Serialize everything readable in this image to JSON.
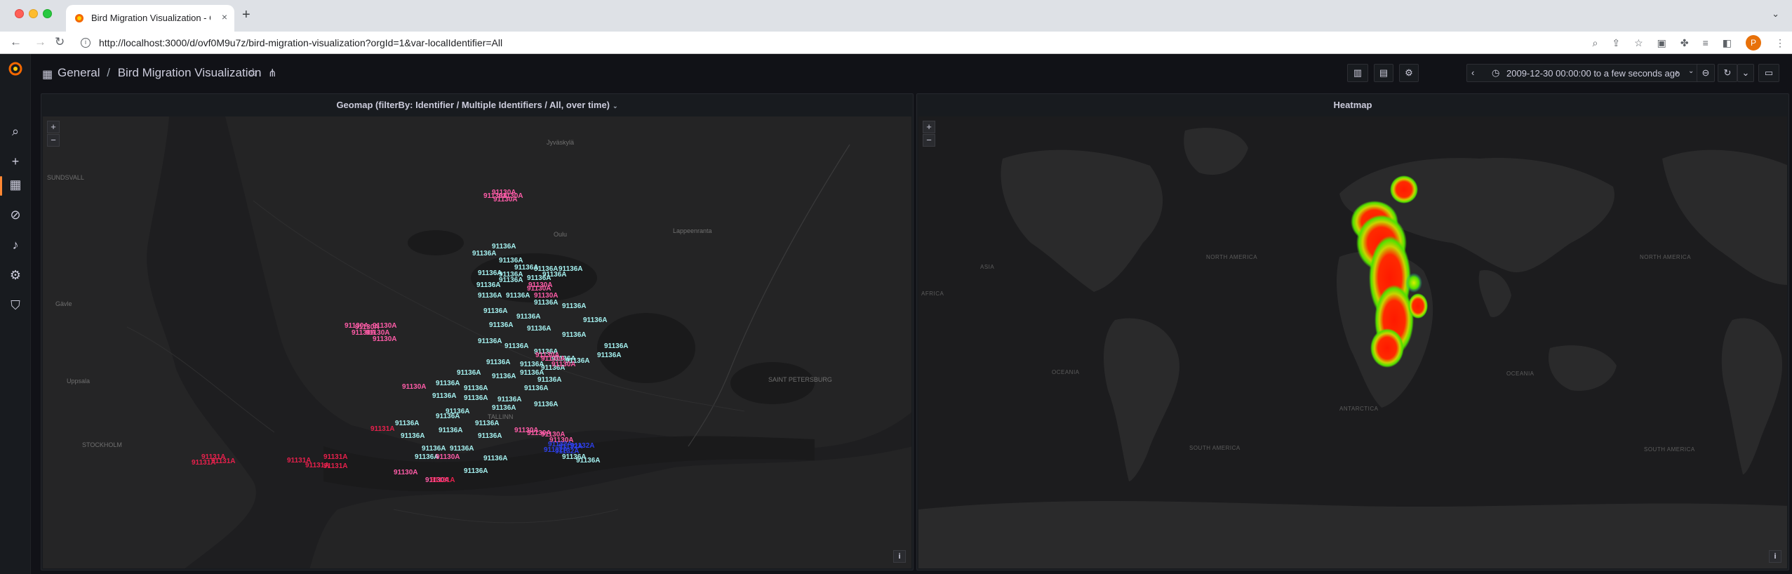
{
  "browser": {
    "tab_title": "Bird Migration Visualization - G",
    "new_tab": "+",
    "tab_close": "×",
    "url": "http://localhost:3000/d/ovf0M9u7z/bird-migration-visualization?orgId=1&var-localIdentifier=All",
    "profile_initial": "P"
  },
  "header": {
    "folder": "General",
    "separator": "/",
    "dashboard_title": "Bird Migration Visualization",
    "time_range": "2009-12-30 00:00:00 to a few seconds ago"
  },
  "panels": [
    {
      "title": "Geomap (filterBy: Identifier / Multiple Identifiers / All, over time)",
      "zoom_in": "+",
      "zoom_out": "−",
      "attribution": "i",
      "places": {
        "sundsvall": "SUNDSVALL",
        "stockholm": "STOCKHOLM",
        "saint_petersburg": "SAINT PETERSBURG",
        "tallinn": "TALLINN",
        "uppsala": "Uppsala",
        "gavle": "Gävle",
        "lappeenranta": "Lappeenranta",
        "jyvaskyla": "Jyväskylä",
        "oulu": "Oulu"
      },
      "markers": {
        "cyan": "91136A",
        "pink": "91130A",
        "red": "91131A",
        "blue": "91132A"
      }
    },
    {
      "title": "Heatmap",
      "zoom_in": "+",
      "zoom_out": "−",
      "attribution": "i",
      "places": {
        "north_america": "NORTH AMERICA",
        "south_america": "SOUTH AMERICA",
        "africa": "AFRICA",
        "asia": "ASIA",
        "oceania": "OCEANIA",
        "antarctica": "ANTARCTICA",
        "north_america_2": "NORTH AMERICA",
        "south_america_2": "SOUTH AMERICA",
        "oceania_2": "OCEANIA"
      }
    }
  ],
  "colors": {
    "cyan": "#a5f1f0",
    "pink": "#ff5ca8",
    "red": "#e8204c",
    "blue": "#2d3fe8",
    "accent": "#ff8833",
    "heat_core": "#ff1a00",
    "heat_edge": "#52e000"
  }
}
